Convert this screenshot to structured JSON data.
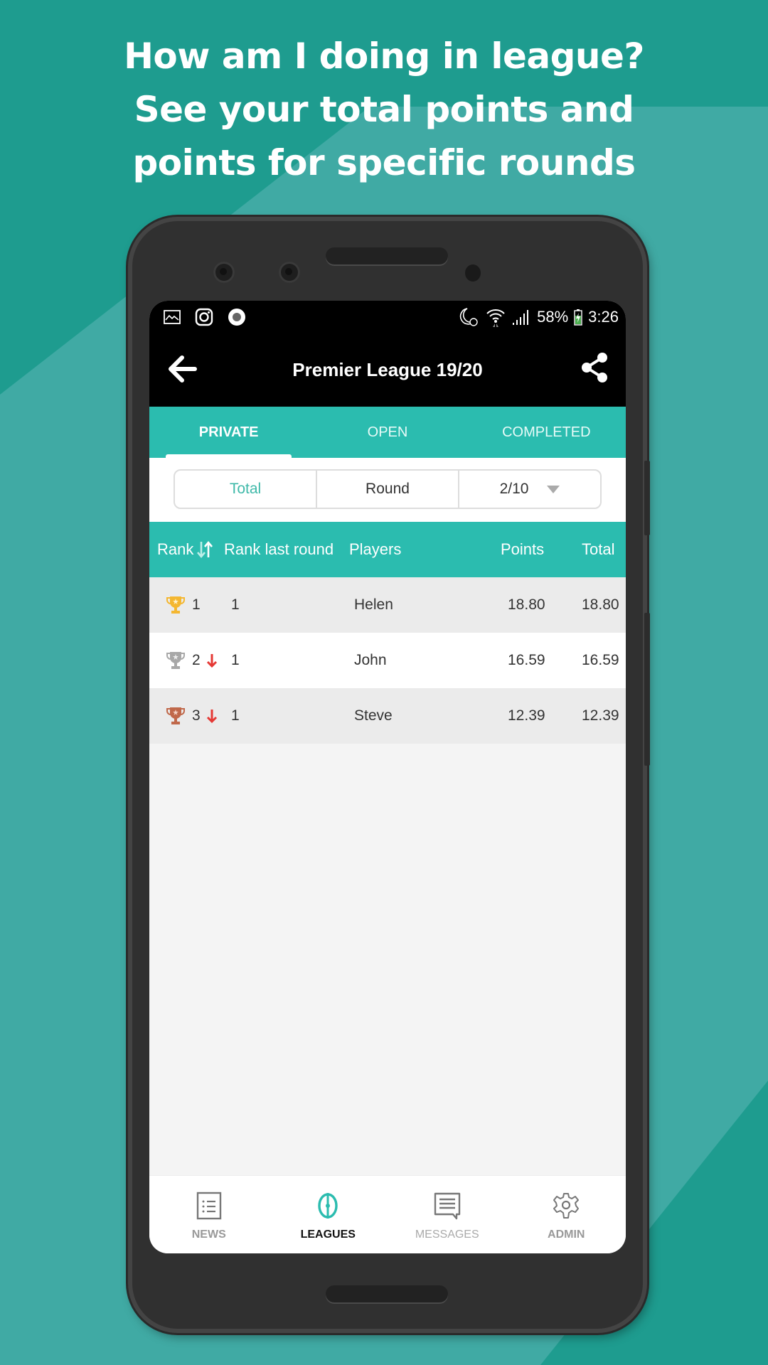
{
  "headline": {
    "lines": [
      "How am I doing in league?",
      "See your total points and",
      "points for specific rounds"
    ]
  },
  "status_bar": {
    "left_icons": [
      "gallery-icon",
      "instagram-icon",
      "record-icon"
    ],
    "right_icons": [
      "night-mode-alarm-icon",
      "wifi-icon",
      "signal-icon"
    ],
    "battery": "58%",
    "time": "3:26"
  },
  "app_bar": {
    "title": "Premier League 19/20",
    "back_icon": "arrow-left-icon",
    "share_icon": "share-icon"
  },
  "tabs": [
    {
      "label": "PRIVATE",
      "active": true
    },
    {
      "label": "OPEN",
      "active": false
    },
    {
      "label": "COMPLETED",
      "active": false
    }
  ],
  "filter": {
    "options": [
      {
        "label": "Total",
        "active": true
      },
      {
        "label": "Round",
        "active": false
      }
    ],
    "round_select": "2/10"
  },
  "table": {
    "headers": {
      "rank": "Rank",
      "rank_last_round": "Rank last round",
      "players": "Players",
      "points": "Points",
      "total": "Total"
    },
    "rows": [
      {
        "trophy": "gold",
        "rank": "1",
        "trend": "none",
        "rank_last_round": "1",
        "player": "Helen",
        "points": "18.80",
        "total": "18.80"
      },
      {
        "trophy": "silver",
        "rank": "2",
        "trend": "down",
        "rank_last_round": "1",
        "player": "John",
        "points": "16.59",
        "total": "16.59"
      },
      {
        "trophy": "bronze",
        "rank": "3",
        "trend": "down",
        "rank_last_round": "1",
        "player": "Steve",
        "points": "12.39",
        "total": "12.39"
      }
    ]
  },
  "bottom_nav": [
    {
      "label": "NEWS",
      "icon": "news-list-icon",
      "active": false
    },
    {
      "label": "LEAGUES",
      "icon": "leagues-icon",
      "active": true
    },
    {
      "label": "MESSAGES",
      "icon": "message-icon",
      "active": false
    },
    {
      "label": "ADMIN",
      "icon": "gear-icon",
      "active": false
    }
  ],
  "colors": {
    "accent": "#2bbcaf",
    "background": "#1e9c8f",
    "gold": "#f4b731",
    "silver": "#a8a8a8",
    "bronze": "#c0684a",
    "down_arrow": "#e53935"
  }
}
